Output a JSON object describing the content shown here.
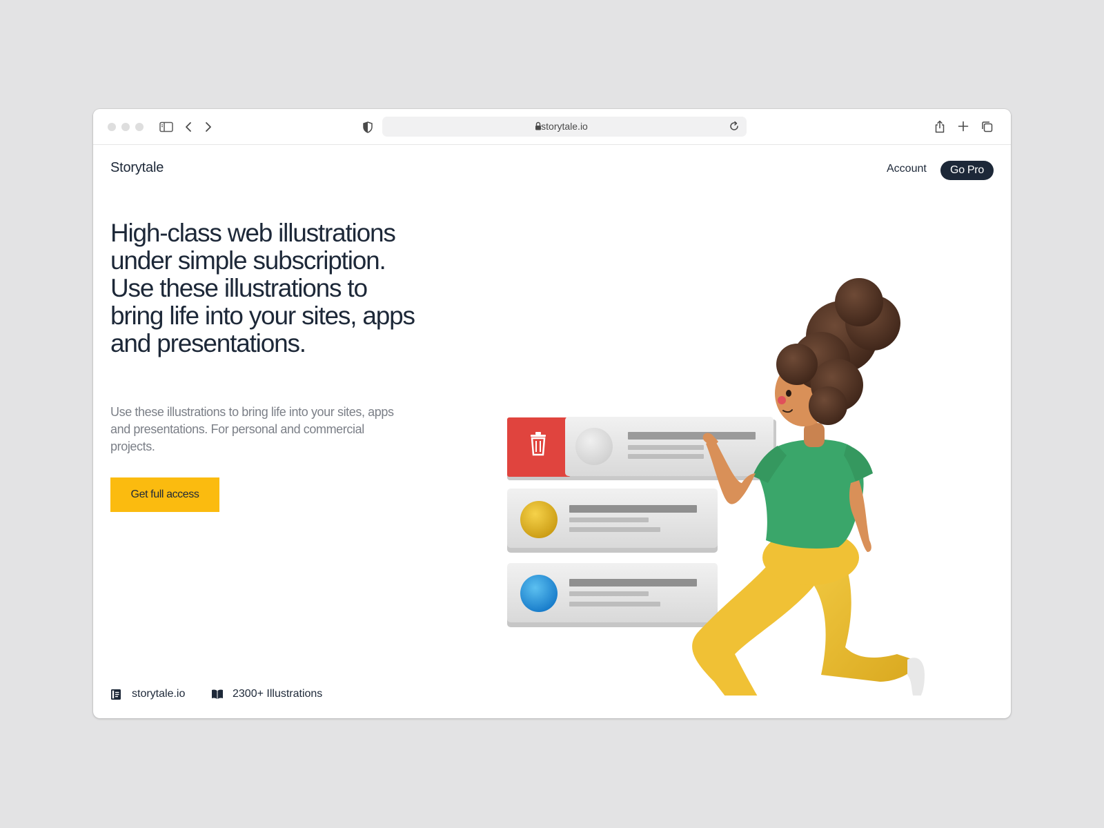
{
  "browser": {
    "url": "storytale.io"
  },
  "nav": {
    "brand": "Storytale",
    "account_label": "Account",
    "gopro_label": "Go Pro"
  },
  "hero": {
    "headline": "High-class web illustrations under simple subscription. Use these illustrations to bring life into your sites, apps and presentations.",
    "subtext": "Use these illustrations to bring life into your sites, apps and presentations. For personal and commercial projects.",
    "cta_label": "Get full access"
  },
  "footer": {
    "site_label": "storytale.io",
    "count_label": "2300+ Illustrations"
  },
  "colors": {
    "navy": "#1d2838",
    "cta_yellow": "#fbbb0f",
    "delete_red": "#e0443e",
    "shirt_green": "#3aa66a",
    "pants_yellow": "#f0c135"
  }
}
